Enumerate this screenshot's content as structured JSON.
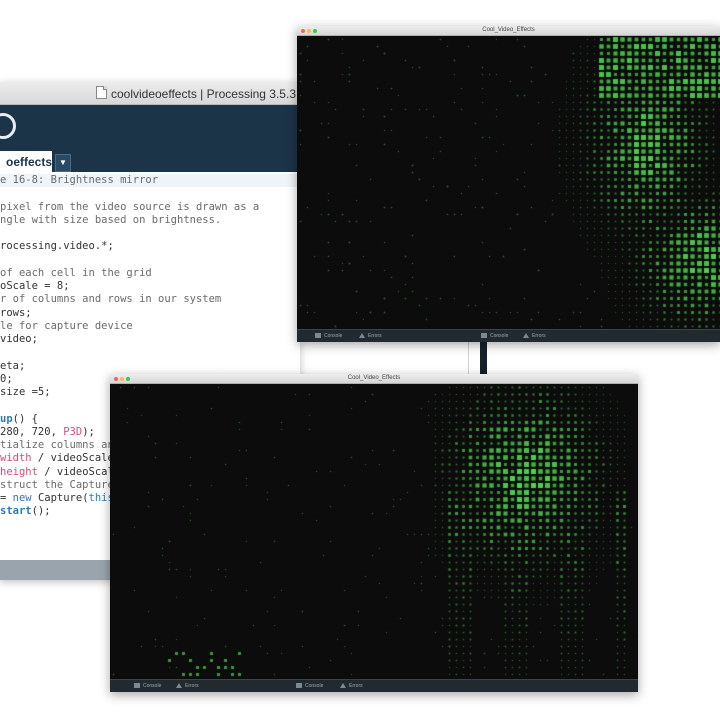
{
  "ide": {
    "title": "coolvideoeffects | Processing 3.5.3",
    "tab_label": "oeffects",
    "tab_menu_glyph": "▼",
    "code_lines": [
      [
        {
          "t": "e 16-8: Brightness mirror",
          "c": "com"
        }
      ],
      [],
      [
        {
          "t": "pixel from the video source is drawn as a",
          "c": "com"
        }
      ],
      [
        {
          "t": "ngle with size based on brightness.",
          "c": "com"
        }
      ],
      [],
      [
        {
          "t": "rocessing.video.*;",
          "c": ""
        }
      ],
      [],
      [
        {
          "t": "of each cell in the grid",
          "c": "com"
        }
      ],
      [
        {
          "t": "oScale = 8;",
          "c": ""
        }
      ],
      [
        {
          "t": "r of columns and rows in our system",
          "c": "com"
        }
      ],
      [
        {
          "t": "rows;",
          "c": ""
        }
      ],
      [
        {
          "t": "le for capture device",
          "c": "com"
        }
      ],
      [
        {
          "t": "video;",
          "c": ""
        }
      ],
      [],
      [
        {
          "t": "eta;",
          "c": ""
        }
      ],
      [
        {
          "t": "0;",
          "c": ""
        }
      ],
      [
        {
          "t": "size =5;",
          "c": ""
        }
      ],
      [],
      [
        {
          "t": "up",
          "c": "fn"
        },
        {
          "t": "() {",
          "c": ""
        }
      ],
      [
        {
          "t": "280, 720, ",
          "c": ""
        },
        {
          "t": "P3D",
          "c": "num"
        },
        {
          "t": ");",
          "c": ""
        }
      ],
      [
        {
          "t": "tialize columns and",
          "c": "com"
        }
      ],
      [
        {
          "t": "width",
          "c": "var"
        },
        {
          "t": " / videoScale;",
          "c": ""
        }
      ],
      [
        {
          "t": "height",
          "c": "var"
        },
        {
          "t": " / videoScale",
          "c": ""
        }
      ],
      [
        {
          "t": "struct the Capture o",
          "c": "com"
        }
      ],
      [
        {
          "t": "= ",
          "c": ""
        },
        {
          "t": "new",
          "c": "kw"
        },
        {
          "t": " Capture(",
          "c": ""
        },
        {
          "t": "this",
          "c": "kw"
        },
        {
          "t": ",",
          "c": ""
        }
      ],
      [
        {
          "t": "start",
          "c": "fn"
        },
        {
          "t": "();",
          "c": ""
        }
      ]
    ]
  },
  "sketch_windows": [
    {
      "title": "Cool_Video_Effects",
      "console_label": "Console",
      "errors_label": "Errors",
      "console_label_2": "Console",
      "errors_label_2": "Errors"
    },
    {
      "title": "Cool_Video_Effects",
      "console_label": "Console",
      "errors_label": "Errors",
      "console_label_2": "Console",
      "errors_label_2": "Errors"
    }
  ],
  "colors": {
    "ide_toolbar": "#1c3448",
    "sketch_background": "#0c0c0c",
    "pixel_green": "#4fc04f"
  }
}
